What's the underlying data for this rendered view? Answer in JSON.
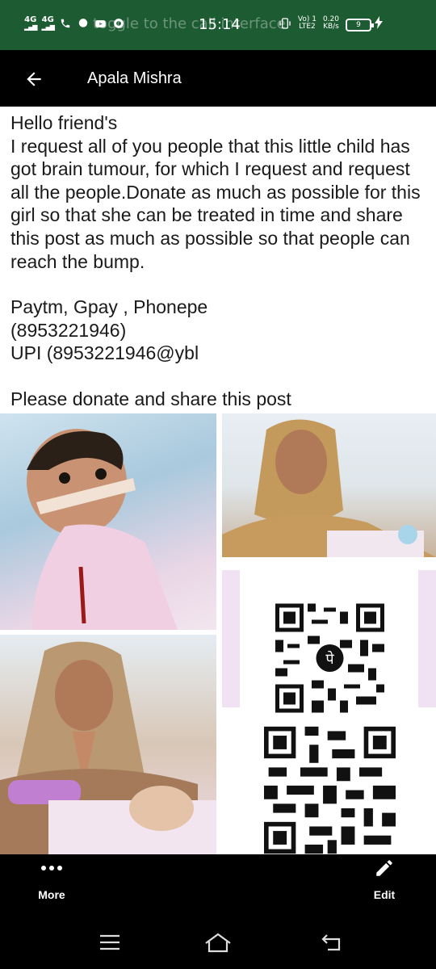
{
  "status_bar": {
    "network1": "4G",
    "network2": "4G",
    "ghost_text": "toggle to the call interface",
    "time": "15:14",
    "volte": "Vo) 1",
    "lte": "LTE2",
    "speed": "0.20",
    "speed_unit": "KB/s",
    "battery": "9"
  },
  "app_bar": {
    "title": "Apala Mishra",
    "back_icon": "arrow-left-icon"
  },
  "post": {
    "greeting": "Hello friend's",
    "body": "I request all of you people that this little child has got brain tumour, for which I request and request all the people.Donate as much as possible for this girl so that she can be treated in time and share this post as much as possible so that people can reach the bump.",
    "payment_line": "Paytm, Gpay , Phonepe",
    "phone_line": "(8953221946)",
    "upi_line": "UPI (8953221946@ybl",
    "closing": "Please donate and share this post"
  },
  "photos": {
    "qr_badge": "पे"
  },
  "actions": {
    "more_label": "More",
    "edit_label": "Edit"
  },
  "colors": {
    "status_bar": "#1d5b33",
    "app_bar": "#000000",
    "background": "#ffffff"
  }
}
